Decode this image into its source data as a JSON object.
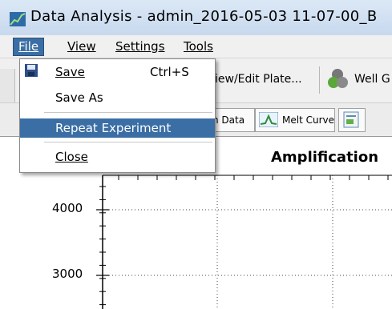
{
  "window": {
    "title": "Data Analysis - admin_2016-05-03 11-07-00_B"
  },
  "menu": {
    "file": "File",
    "view": "View",
    "settings": "Settings",
    "tools": "Tools"
  },
  "file_menu": {
    "save": "Save",
    "save_shortcut": "Ctrl+S",
    "save_as": "Save As",
    "repeat": "Repeat Experiment",
    "close": "Close"
  },
  "toolbar": {
    "view_edit_plate": "iew/Edit Plate...",
    "well": "Well G"
  },
  "tabs": {
    "run_data": "n Data",
    "melt_curve": "Melt Curve"
  },
  "chart": {
    "title": "Amplification",
    "y_ticks": [
      "4000",
      "3000"
    ]
  },
  "chart_data": {
    "type": "line",
    "title": "Amplification",
    "xlabel": "",
    "ylabel": "",
    "y_tick_labels": [
      4000,
      3000
    ],
    "grid": true,
    "series": []
  },
  "colors": {
    "highlight": "#3a6ea5",
    "titlebar": "#c8d9ee"
  }
}
